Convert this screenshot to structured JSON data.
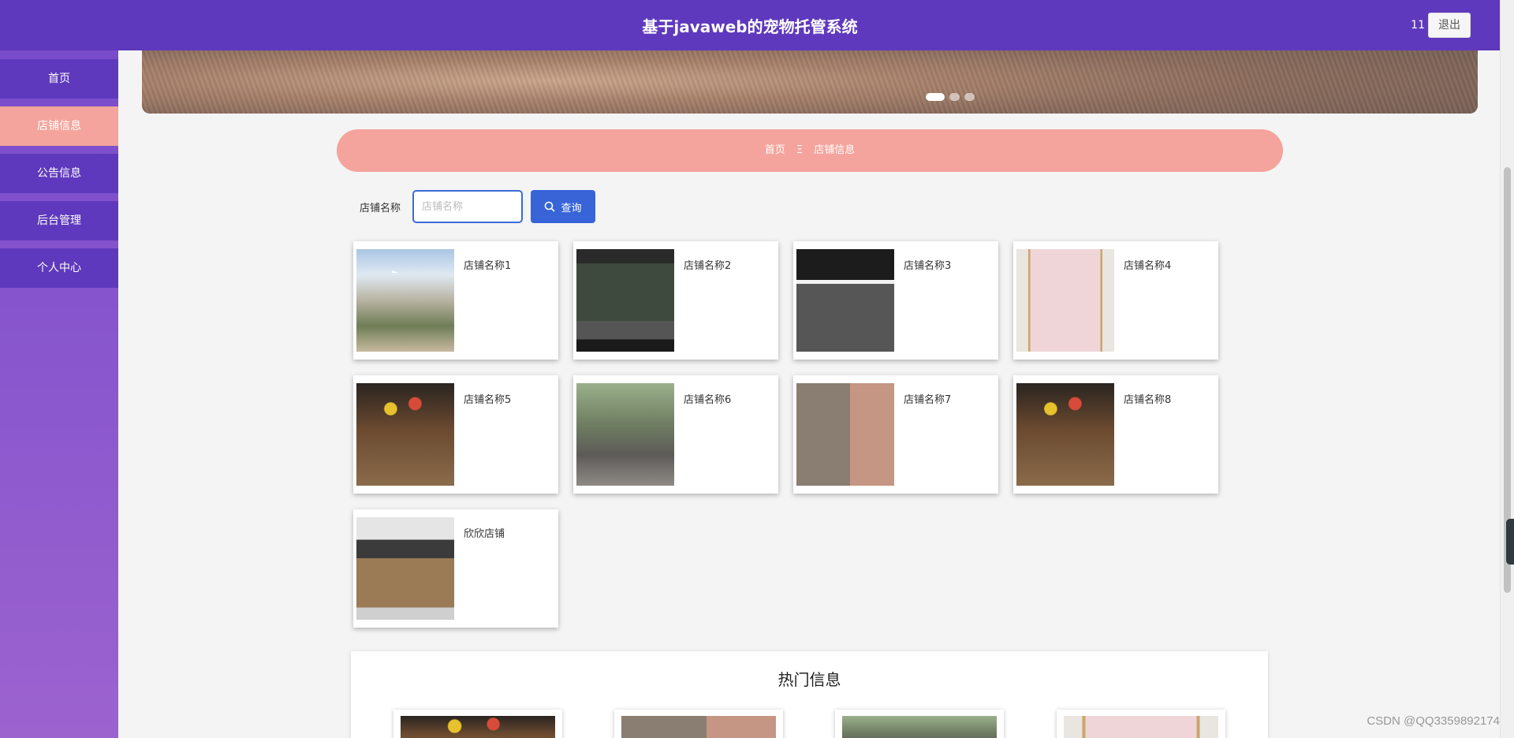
{
  "header": {
    "title": "基于javaweb的宠物托管系统",
    "user": "11",
    "logout_label": "退出"
  },
  "sidebar": {
    "items": [
      {
        "label": "首页",
        "active": false
      },
      {
        "label": "店铺信息",
        "active": true
      },
      {
        "label": "公告信息",
        "active": false
      },
      {
        "label": "后台管理",
        "active": false
      },
      {
        "label": "个人中心",
        "active": false
      }
    ]
  },
  "banner": {
    "slides": 3,
    "active_slide": 1
  },
  "breadcrumb": {
    "home": "首页",
    "separator": "Ξ",
    "current": "店铺信息"
  },
  "search": {
    "label": "店铺名称",
    "placeholder": "店铺名称",
    "button_label": "查询"
  },
  "shops": [
    {
      "name": "店铺名称1"
    },
    {
      "name": "店铺名称2"
    },
    {
      "name": "店铺名称3"
    },
    {
      "name": "店铺名称4"
    },
    {
      "name": "店铺名称5"
    },
    {
      "name": "店铺名称6"
    },
    {
      "name": "店铺名称7"
    },
    {
      "name": "店铺名称8"
    },
    {
      "name": "欣欣店铺"
    }
  ],
  "hot": {
    "title": "热门信息"
  },
  "watermark": "CSDN @QQ3359892174",
  "colors": {
    "header": "#5f39bd",
    "active_nav": "#f4a49c",
    "primary_button": "#3864d8"
  }
}
